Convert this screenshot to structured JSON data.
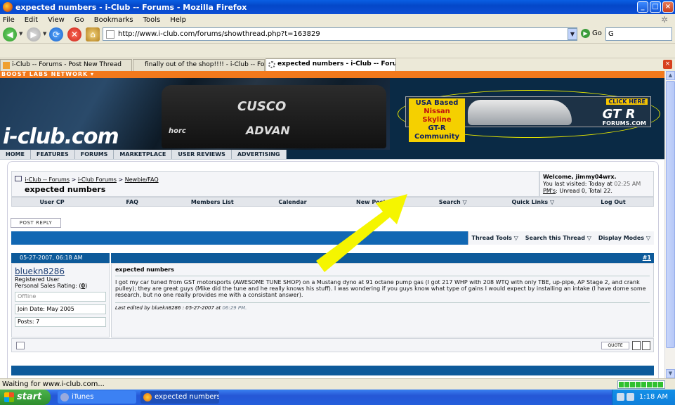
{
  "window": {
    "title": "expected numbers - i-Club -- Forums - Mozilla Firefox"
  },
  "menu": [
    "File",
    "Edit",
    "View",
    "Go",
    "Bookmarks",
    "Tools",
    "Help"
  ],
  "nav": {
    "url": "http://www.i-club.com/forums/showthread.php?t=163829",
    "go_label": "Go",
    "search_value": "G"
  },
  "tabs": [
    {
      "label": "i-Club -- Forums - Post New Thread",
      "active": false
    },
    {
      "label": "finally out of the shop!!!! - i-Club -- Forums",
      "active": false
    },
    {
      "label": "expected numbers - i-Club -- Forums",
      "active": true
    }
  ],
  "page": {
    "network_label": "BOOST LABS NETWORK ▾",
    "logo": "i-club.com",
    "ad": {
      "line1": "USA Based",
      "line2": "Nissan Skyline",
      "line3": "GT-R Community",
      "click": "CLICK HERE",
      "brand": "GT R",
      "brand_sub": "FORUMS.COM"
    },
    "sitenav": [
      "HOME",
      "FEATURES",
      "FORUMS",
      "MARKETPLACE",
      "USER REVIEWS",
      "ADVERTISING"
    ],
    "breadcrumb": {
      "root": "i-Club -- Forums",
      "sep1": ">",
      "mid": "i-Club Forums",
      "sep2": ">",
      "leaf": "Newbie/FAQ"
    },
    "thread_title": "expected numbers",
    "welcome": {
      "greeting": "Welcome, jimmy04wrx.",
      "last_visit": "You last visited: Today at",
      "last_visit_time": "02:25 AM",
      "pms_link": "PM's",
      "pms_text": ": Unread 0, Total 22."
    },
    "forumnav": [
      "User CP",
      "FAQ",
      "Members List",
      "Calendar",
      "New Posts",
      "Search ▽",
      "Quick Links ▽",
      "Log Out"
    ],
    "post_reply": "POST REPLY",
    "thread_tools": [
      "Thread Tools ▽",
      "Search this Thread ▽",
      "Display Modes ▽"
    ],
    "post": {
      "date": "05-27-2007, 06:18 AM",
      "number": "#1",
      "username": "bluekn8286",
      "usertitle": "Registered User",
      "rating_label": "Personal Sales Rating: (",
      "rating_value": "0",
      "rating_end": ")",
      "status": "Offline",
      "join_date": "Join Date: May 2005",
      "posts": "Posts: 7",
      "title": "expected numbers",
      "body": "I got my car tuned from GST motorsports (AWESOME TUNE SHOP) on a Mustang dyno at 91 octane pump gas (I got 217 WHP with 208 WTQ with only TBE, up-pipe, AP Stage 2, and crank pulley); they are great guys (Mike did the tune and he really knows his stuff). I was wondering if you guys know what type of gains I would expect by installing an intake (I have dome some research, but no one really provides me with a consistant answer).",
      "edit_prefix": "Last edited by bluekn8286 : 05-27-2007 at",
      "edit_time": "06:29 PM.",
      "quote_label": "QUOTE"
    }
  },
  "status": "Waiting for www.i-club.com...",
  "taskbar": {
    "start": "start",
    "items": [
      "iTunes",
      "expected numbers - i..."
    ],
    "clock": "1:18 AM"
  },
  "colors": {
    "accent_orange": "#f2791c",
    "forum_blue": "#0d5a9a",
    "arrow_yellow": "#f5f500"
  }
}
